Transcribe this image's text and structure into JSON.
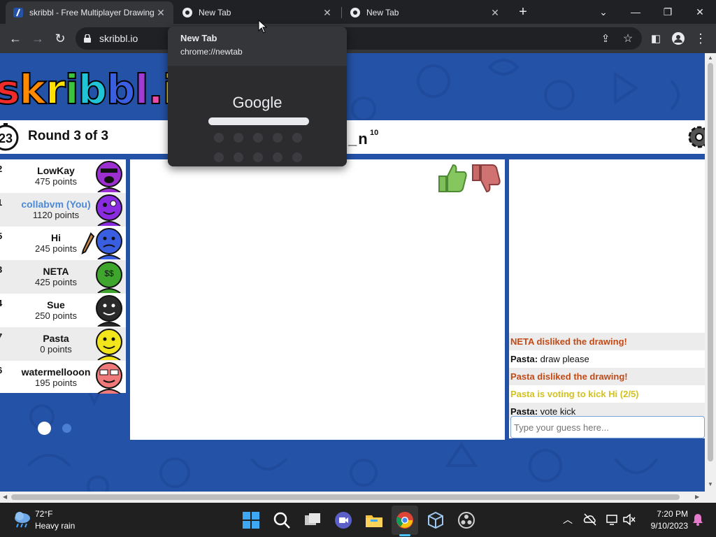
{
  "browser": {
    "tabs": [
      {
        "title": "skribbl - Free Multiplayer Drawing",
        "state": "active"
      },
      {
        "title": "New Tab",
        "state": "inactive"
      },
      {
        "title": "New Tab",
        "state": "inactive"
      }
    ],
    "address": "skribbl.io",
    "hover_card": {
      "title": "New Tab",
      "url": "chrome://newtab",
      "preview_text": "Google"
    }
  },
  "game": {
    "logo_text": "skribbl.io",
    "timer": "23",
    "round_label": "Round 3 of 3",
    "word_hint": "_n",
    "word_length": "10",
    "players": [
      {
        "rank": "2",
        "name": "LowKay",
        "points": "475 points",
        "color": "#9b2fd0"
      },
      {
        "rank": "1",
        "name": "collabvm (You)",
        "points": "1120 points",
        "color": "#8a2be2"
      },
      {
        "rank": "5",
        "name": "Hi",
        "points": "245 points",
        "color": "#3a5ee0"
      },
      {
        "rank": "3",
        "name": "NETA",
        "points": "425 points",
        "color": "#3fa62d"
      },
      {
        "rank": "4",
        "name": "Sue",
        "points": "250 points",
        "color": "#2a2a2a"
      },
      {
        "rank": "7",
        "name": "Pasta",
        "points": "0 points",
        "color": "#f2e51b"
      },
      {
        "rank": "6",
        "name": "watermellooon",
        "points": "195 points",
        "color": "#f07a7a"
      }
    ],
    "chat": [
      {
        "author": "",
        "text": "NETA disliked the drawing!",
        "style": "red"
      },
      {
        "author": "Pasta:",
        "text": " draw please",
        "style": "normal"
      },
      {
        "author": "",
        "text": "Pasta disliked the drawing!",
        "style": "red"
      },
      {
        "author": "",
        "text": "Pasta is voting to kick Hi (2/5)",
        "style": "yellow"
      },
      {
        "author": "Pasta:",
        "text": " vote kick",
        "style": "normal"
      }
    ],
    "guess_placeholder": "Type your guess here..."
  },
  "taskbar": {
    "weather_temp": "72°F",
    "weather_desc": "Heavy rain",
    "time": "7:20 PM",
    "date": "9/10/2023",
    "apps": [
      "start-icon",
      "search-icon",
      "task-view-icon",
      "meet-icon",
      "file-explorer-icon",
      "chrome-icon",
      "virtualbox-icon",
      "obs-icon"
    ]
  },
  "colors": {
    "page_bg": "#2452a6",
    "you": "#4c8ad8",
    "chat_red": "#c24a17",
    "chat_yellow": "#d3c21c"
  }
}
